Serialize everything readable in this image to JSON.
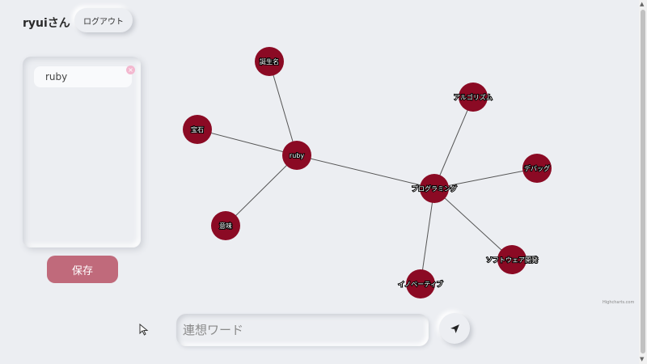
{
  "header": {
    "user_name": "ryuiさん",
    "logout_label": "ログアウト"
  },
  "sidebar": {
    "tags": [
      {
        "label": "ruby"
      }
    ],
    "tag_close_symbol": "×",
    "save_label": "保存"
  },
  "graph": {
    "node_color": "#8b0a24",
    "edge_color": "#555555",
    "nodes": [
      {
        "id": "ruby",
        "label": "ruby"
      },
      {
        "id": "tanjou",
        "label": "誕生名"
      },
      {
        "id": "hoseki",
        "label": "宝石"
      },
      {
        "id": "imi",
        "label": "意味"
      },
      {
        "id": "programming",
        "label": "プログラミング"
      },
      {
        "id": "algorithm",
        "label": "アルゴリズム"
      },
      {
        "id": "debug",
        "label": "デバッグ"
      },
      {
        "id": "software",
        "label": "ソフトウェア開発"
      },
      {
        "id": "innovative",
        "label": "イノベーティブ"
      }
    ],
    "edges": [
      [
        "ruby",
        "tanjou"
      ],
      [
        "ruby",
        "hoseki"
      ],
      [
        "ruby",
        "imi"
      ],
      [
        "ruby",
        "programming"
      ],
      [
        "programming",
        "algorithm"
      ],
      [
        "programming",
        "debug"
      ],
      [
        "programming",
        "software"
      ],
      [
        "programming",
        "innovative"
      ]
    ],
    "credit": "Highcharts.com"
  },
  "composer": {
    "placeholder": "連想ワード",
    "send_icon": "send-icon"
  }
}
